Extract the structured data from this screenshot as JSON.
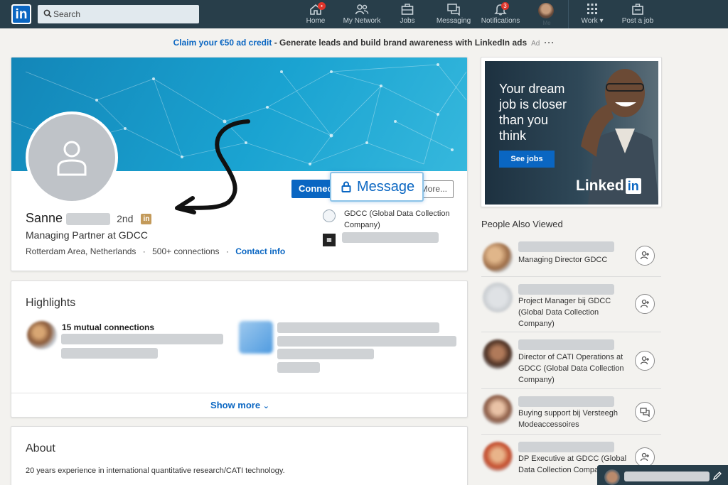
{
  "nav": {
    "search_placeholder": "Search",
    "items": [
      {
        "label": "Home",
        "badge": "•"
      },
      {
        "label": "My Network"
      },
      {
        "label": "Jobs"
      },
      {
        "label": "Messaging"
      },
      {
        "label": "Notifications",
        "badge": "3"
      },
      {
        "label": "Me"
      },
      {
        "label": "Work"
      },
      {
        "label": "Post a job"
      }
    ]
  },
  "ad_banner": {
    "link": "Claim your €50 ad credit",
    "rest": " - Generate leads and build brand awareness with LinkedIn ads",
    "tag": "Ad",
    "more": "···"
  },
  "profile": {
    "first_name": "Sanne",
    "degree": "2nd",
    "badge": "in",
    "headline": "Managing Partner at GDCC",
    "location": "Rotterdam Area, Netherlands",
    "connections": "500+ connections",
    "contact": "Contact info",
    "sep": "·",
    "company": "GDCC (Global Data Collection Company)",
    "buttons": {
      "connect": "Connect",
      "message": "Message",
      "more": "More..."
    }
  },
  "highlights": {
    "title": "Highlights",
    "mutual": "15 mutual connections",
    "show_more": "Show more"
  },
  "about": {
    "title": "About",
    "text": "20 years experience in international quantitative research/CATI technology."
  },
  "right_ad": {
    "headline": "Your dream job is closer than you think",
    "button": "See jobs",
    "brand": "Linked",
    "brand_in": "in"
  },
  "people_also_viewed": {
    "title": "People Also Viewed",
    "people": [
      {
        "headline": "Managing Director GDCC",
        "action": "connect"
      },
      {
        "headline": "Project Manager bij GDCC (Global Data Collection Company)",
        "action": "connect"
      },
      {
        "headline": "Director of CATI Operations at GDCC (Global Data Collection Company)",
        "action": "connect"
      },
      {
        "headline": "Buying support bij Versteegh Modeaccessoires",
        "action": "message"
      },
      {
        "headline": "DP Executive at GDCC (Global Data Collection Company)",
        "action": "connect"
      }
    ]
  },
  "colors": {
    "nav_bg": "#283e4a",
    "brand_blue": "#0a66c2",
    "page_bg": "#f3f2ef"
  }
}
